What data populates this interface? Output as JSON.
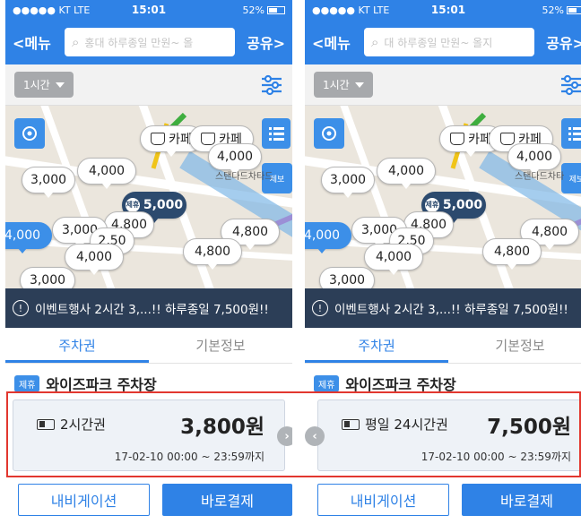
{
  "status": {
    "carrier": "●●●●● KT  LTE",
    "time": "15:01",
    "battery": "52%"
  },
  "nav": {
    "menu_label": "<메뉴",
    "share_label": "공유>"
  },
  "screens": [
    {
      "search_text": "홍대 하루종일 만원~  올",
      "filter_label": "1시간",
      "notice": "이벤트행사 2시간 3,...!! 하루종일 7,500원!!",
      "tabs": [
        "주차권",
        "기본정보"
      ],
      "lot_badge": "제휴",
      "lot_name": "와이즈파크 주차장",
      "ticket": {
        "name": "2시간권",
        "price": "3,800원",
        "period": "17-02-10 00:00 ~ 23:59까지"
      },
      "buttons": {
        "navigation": "내비게이션",
        "pay": "바로결제"
      },
      "pins": {
        "cafe1": "카페",
        "cafe2": "카페",
        "p4000a": "4,000",
        "p4000b": "4,000",
        "p3000a": "3,000",
        "p5000": "5,000",
        "p5000_badge": "제휴",
        "p4800a": "4,800",
        "p3000b": "3,000",
        "p4000c": "4,000",
        "p4000d": "4,000",
        "p4800b": "4,800",
        "p4800c": "4,800",
        "p3000c": "3,000",
        "p2500": "2,50"
      },
      "map_labels": {
        "star": "스탠다드차타드",
        "report": "제보"
      }
    },
    {
      "search_text": "대 하루종일 만원~  올지",
      "filter_label": "1시간",
      "notice": "이벤트행사 2시간 3,...!! 하루종일 7,500원!!",
      "tabs": [
        "주차권",
        "기본정보"
      ],
      "lot_badge": "제휴",
      "lot_name": "와이즈파크 주차장",
      "ticket": {
        "name": "평일 24시간권",
        "price": "7,500원",
        "period": "17-02-10 00:00 ~ 23:59까지"
      },
      "buttons": {
        "navigation": "내비게이션",
        "pay": "바로결제"
      },
      "pins": {
        "cafe1": "카페",
        "cafe2": "카페",
        "p4000a": "4,000",
        "p4000b": "4,000",
        "p3000a": "3,000",
        "p5000": "5,000",
        "p5000_badge": "제휴",
        "p4800a": "4,800",
        "p3000b": "3,000",
        "p4000c": "4,000",
        "p4000d": "4,000",
        "p4800b": "4,800",
        "p4800c": "4,800",
        "p3000c": "3,000",
        "p2500": "2,50"
      },
      "map_labels": {
        "star": "스탠다드차타",
        "report": "제보"
      }
    }
  ],
  "colors": {
    "brand": "#2f82e6",
    "notice_bg": "#2c3e57",
    "highlight": "#e2372f"
  }
}
